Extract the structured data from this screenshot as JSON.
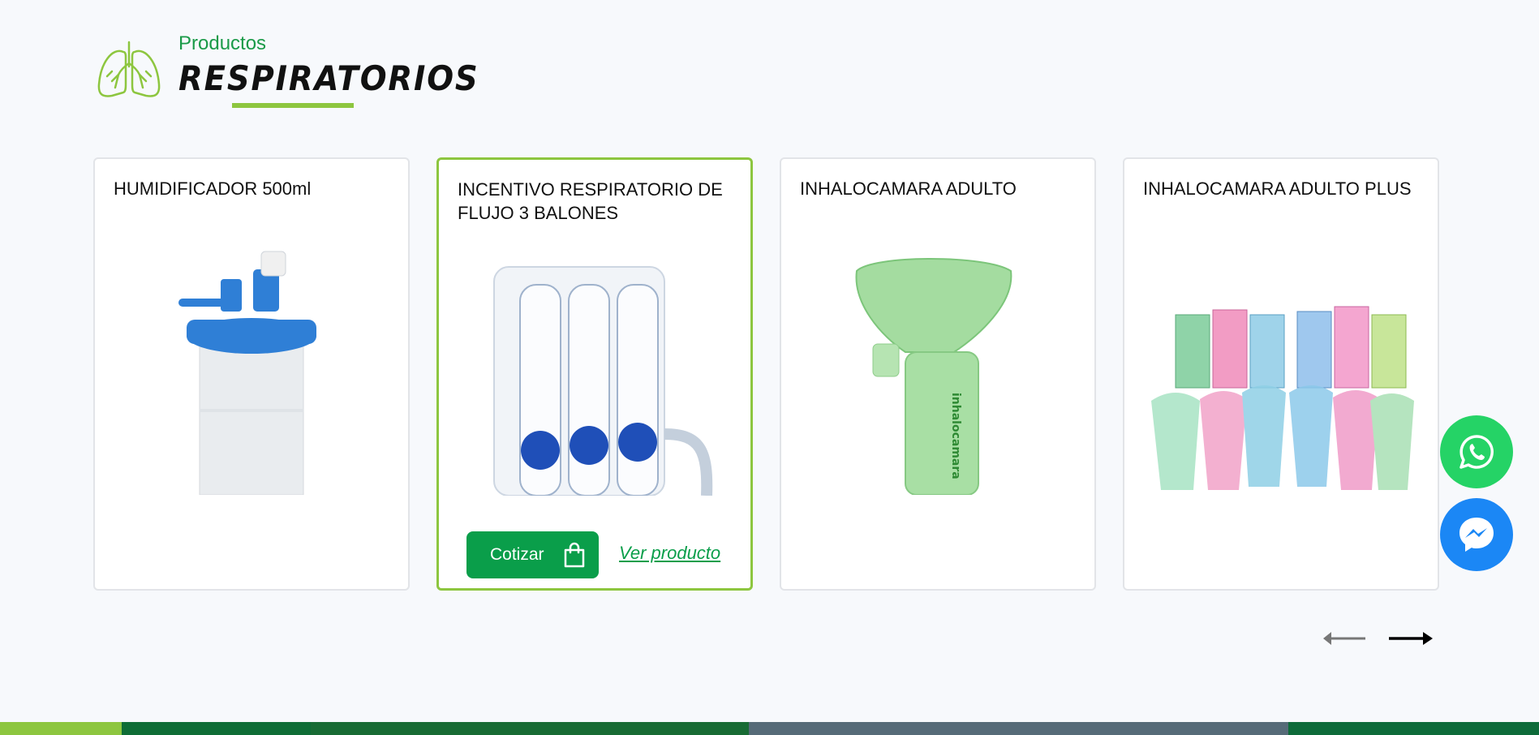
{
  "header": {
    "eyebrow": "Productos",
    "title": "RESPIRATORIOS",
    "icon": "lungs-icon",
    "accent_color": "#8dc63f"
  },
  "products": [
    {
      "name": "HUMIDIFICADOR 500ml",
      "image": "humidifier-image"
    },
    {
      "name": "INCENTIVO RESPIRATORIO DE FLUJO 3 BALONES",
      "image": "incentive-spirometer-image",
      "cta_label": "Cotizar",
      "cta_icon": "shopping-bag-icon",
      "link_label": "Ver producto"
    },
    {
      "name": "INHALOCAMARA ADULTO",
      "image": "inhaler-chamber-image",
      "image_text": "inhalocamara"
    },
    {
      "name": "INHALOCAMARA ADULTO PLUS",
      "image": "inhaler-chamber-set-image"
    }
  ],
  "navigation": {
    "prev_icon": "arrow-left-icon",
    "next_icon": "arrow-right-icon"
  },
  "floating": {
    "whatsapp_icon": "whatsapp-icon",
    "whatsapp_color": "#25d366",
    "messenger_icon": "messenger-icon",
    "messenger_color": "#1b87f5"
  },
  "colors": {
    "primary_green": "#0a9e4a",
    "background": "#f7f9fc",
    "card_border": "#e2e4e8"
  }
}
